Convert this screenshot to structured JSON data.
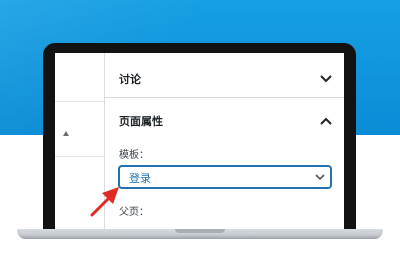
{
  "settings_panel": {
    "discussion": {
      "title": "讨论"
    },
    "page_attributes": {
      "title": "页面属性",
      "template_label": "模板：",
      "template_value": "登录",
      "parent_label": "父页："
    }
  },
  "colors": {
    "background_blue": "#0f94db",
    "arrow": "#e02a24",
    "select_accent": "#2271b1"
  },
  "icons": {
    "discussion_toggle": "chevron-down-icon",
    "page_attributes_toggle": "chevron-up-icon",
    "select_dropdown": "chevron-down-icon",
    "column_sort": "sort-up-icon",
    "annotation": "red-arrow-icon"
  }
}
